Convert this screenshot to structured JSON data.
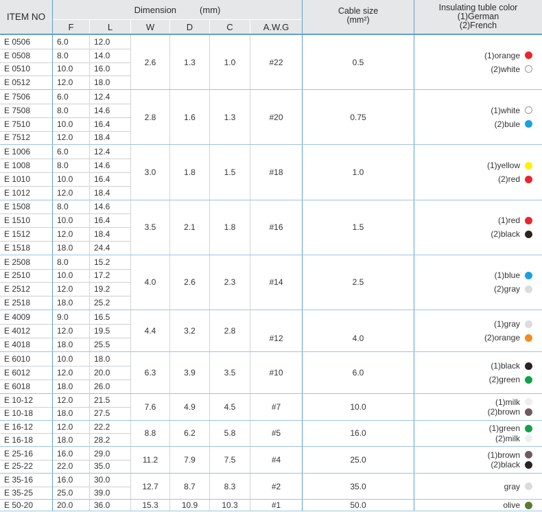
{
  "headers": {
    "item_no": "ITEM NO",
    "dimension": "Dimension",
    "dimension_unit": "(mm)",
    "cable_size": "Cable size",
    "cable_unit": "(mm²)",
    "color_line1": "Insulating tuble color",
    "color_line2": "(1)German",
    "color_line3": "(2)French",
    "col_F": "F",
    "col_L": "L",
    "col_W": "W",
    "col_D": "D",
    "col_C": "C",
    "col_AWG": "A.W.G"
  },
  "groups": [
    {
      "W": "2.6",
      "D": "1.3",
      "C": "1.0",
      "AWG": "#22",
      "cable": "0.5",
      "items": [
        [
          "E 0506",
          "6.0",
          "12.0"
        ],
        [
          "E 0508",
          "8.0",
          "14.0"
        ],
        [
          "E 0510",
          "10.0",
          "16.0"
        ],
        [
          "E 0512",
          "12.0",
          "18.0"
        ]
      ],
      "colors": [
        {
          "label": "(1)orange",
          "hex": "#e8262f",
          "icon": "orange-dot-icon"
        },
        {
          "label": "(2)white",
          "hex": "#ffffff",
          "icon": "white-dot-icon"
        }
      ]
    },
    {
      "W": "2.8",
      "D": "1.6",
      "C": "1.3",
      "AWG": "#20",
      "cable": "0.75",
      "items": [
        [
          "E 7506",
          "6.0",
          "12.4"
        ],
        [
          "E 7508",
          "8.0",
          "14.6"
        ],
        [
          "E 7510",
          "10.0",
          "16.4"
        ],
        [
          "E 7512",
          "12.0",
          "18.4"
        ]
      ],
      "colors": [
        {
          "label": "(1)white",
          "hex": "#ffffff",
          "icon": "white-dot-icon"
        },
        {
          "label": "(2)bule",
          "hex": "#1ba1e2",
          "icon": "blue-dot-icon"
        }
      ]
    },
    {
      "W": "3.0",
      "D": "1.8",
      "C": "1.5",
      "AWG": "#18",
      "cable": "1.0",
      "items": [
        [
          "E 1006",
          "6.0",
          "12.4"
        ],
        [
          "E 1008",
          "8.0",
          "14.6"
        ],
        [
          "E 1010",
          "10.0",
          "16.4"
        ],
        [
          "E 1012",
          "12.0",
          "18.4"
        ]
      ],
      "colors": [
        {
          "label": "(1)yellow",
          "hex": "#fff200",
          "icon": "yellow-dot-icon"
        },
        {
          "label": "(2)red",
          "hex": "#e8262f",
          "icon": "red-dot-icon"
        }
      ]
    },
    {
      "W": "3.5",
      "D": "2.1",
      "C": "1.8",
      "AWG": "#16",
      "cable": "1.5",
      "items": [
        [
          "E 1508",
          "8.0",
          "14.6"
        ],
        [
          "E 1510",
          "10.0",
          "16.4"
        ],
        [
          "E 1512",
          "12.0",
          "18.4"
        ],
        [
          "E 1518",
          "18.0",
          "24.4"
        ]
      ],
      "colors": [
        {
          "label": "(1)red",
          "hex": "#e8262f",
          "icon": "red-dot-icon"
        },
        {
          "label": "(2)black",
          "hex": "#2b2323",
          "icon": "black-dot-icon"
        }
      ]
    },
    {
      "W": "4.0",
      "D": "2.6",
      "C": "2.3",
      "AWG": "#14",
      "cable": "2.5",
      "items": [
        [
          "E 2508",
          "8.0",
          "15.2"
        ],
        [
          "E 2510",
          "10.0",
          "17.2"
        ],
        [
          "E 2512",
          "12.0",
          "19.2"
        ],
        [
          "E 2518",
          "18.0",
          "25.2"
        ]
      ],
      "colors": [
        {
          "label": "(1)blue",
          "hex": "#1ba1e2",
          "icon": "blue-dot-icon"
        },
        {
          "label": "(2)gray",
          "hex": "#dcdcdc",
          "icon": "gray-dot-icon"
        }
      ]
    },
    {
      "W": "4.4",
      "D": "3.2",
      "C": "2.8",
      "AWG": "#12",
      "cable": "4.0",
      "items": [
        [
          "E 4009",
          "9.0",
          "16.5"
        ],
        [
          "E 4012",
          "12.0",
          "19.5"
        ],
        [
          "E 4018",
          "18.0",
          "25.5"
        ]
      ],
      "colors": [
        {
          "label": "(1)gray",
          "hex": "#dcdcdc",
          "icon": "gray-dot-icon"
        },
        {
          "label": "(2)orange",
          "hex": "#f28c1e",
          "icon": "orange-dot-icon"
        }
      ]
    },
    {
      "W": "6.3",
      "D": "3.9",
      "C": "3.5",
      "AWG": "#10",
      "cable": "6.0",
      "items": [
        [
          "E 6010",
          "10.0",
          "18.0"
        ],
        [
          "E 6012",
          "12.0",
          "20.0"
        ],
        [
          "E 6018",
          "18.0",
          "26.0"
        ]
      ],
      "colors": [
        {
          "label": "(1)black",
          "hex": "#2b2323",
          "icon": "black-dot-icon"
        },
        {
          "label": "(2)green",
          "hex": "#12a14a",
          "icon": "green-dot-icon"
        }
      ]
    },
    {
      "W": "7.6",
      "D": "4.9",
      "C": "4.5",
      "AWG": "#7",
      "cable": "10.0",
      "items": [
        [
          "E 10-12",
          "12.0",
          "21.5"
        ],
        [
          "E 10-18",
          "18.0",
          "27.5"
        ]
      ],
      "colors": [
        {
          "label": "(1)milk",
          "hex": "#eeeeee",
          "icon": "milk-dot-icon"
        },
        {
          "label": "(2)brown",
          "hex": "#6e5a62",
          "icon": "brown-dot-icon"
        }
      ]
    },
    {
      "W": "8.8",
      "D": "6.2",
      "C": "5.8",
      "AWG": "#5",
      "cable": "16.0",
      "items": [
        [
          "E 16-12",
          "12.0",
          "22.2"
        ],
        [
          "E 16-18",
          "18.0",
          "28.2"
        ]
      ],
      "colors": [
        {
          "label": "(1)green",
          "hex": "#12a14a",
          "icon": "green-dot-icon"
        },
        {
          "label": "(2)milk",
          "hex": "#eeeeee",
          "icon": "milk-dot-icon"
        }
      ]
    },
    {
      "W": "11.2",
      "D": "7.9",
      "C": "7.5",
      "AWG": "#4",
      "cable": "25.0",
      "items": [
        [
          "E 25-16",
          "16.0",
          "29.0"
        ],
        [
          "E 25-22",
          "22.0",
          "35.0"
        ]
      ],
      "colors": [
        {
          "label": "(1)brown",
          "hex": "#6e5a62",
          "icon": "brown-dot-icon"
        },
        {
          "label": "(2)black",
          "hex": "#2b2323",
          "icon": "black-dot-icon"
        }
      ]
    },
    {
      "W": "12.7",
      "D": "8.7",
      "C": "8.3",
      "AWG": "#2",
      "cable": "35.0",
      "items": [
        [
          "E 35-16",
          "16.0",
          "30.0"
        ],
        [
          "E 35-25",
          "25.0",
          "39.0"
        ]
      ],
      "colors": [
        {
          "label": "gray",
          "hex": "#dcdcdc",
          "icon": "gray-dot-icon"
        }
      ]
    },
    {
      "W": "15.3",
      "D": "10.9",
      "C": "10.3",
      "AWG": "#1",
      "cable": "50.0",
      "items": [
        [
          "E 50-20",
          "20.0",
          "36.0"
        ]
      ],
      "colors": [
        {
          "label": "olive",
          "hex": "#5a7a33",
          "icon": "olive-dot-icon"
        }
      ]
    }
  ]
}
